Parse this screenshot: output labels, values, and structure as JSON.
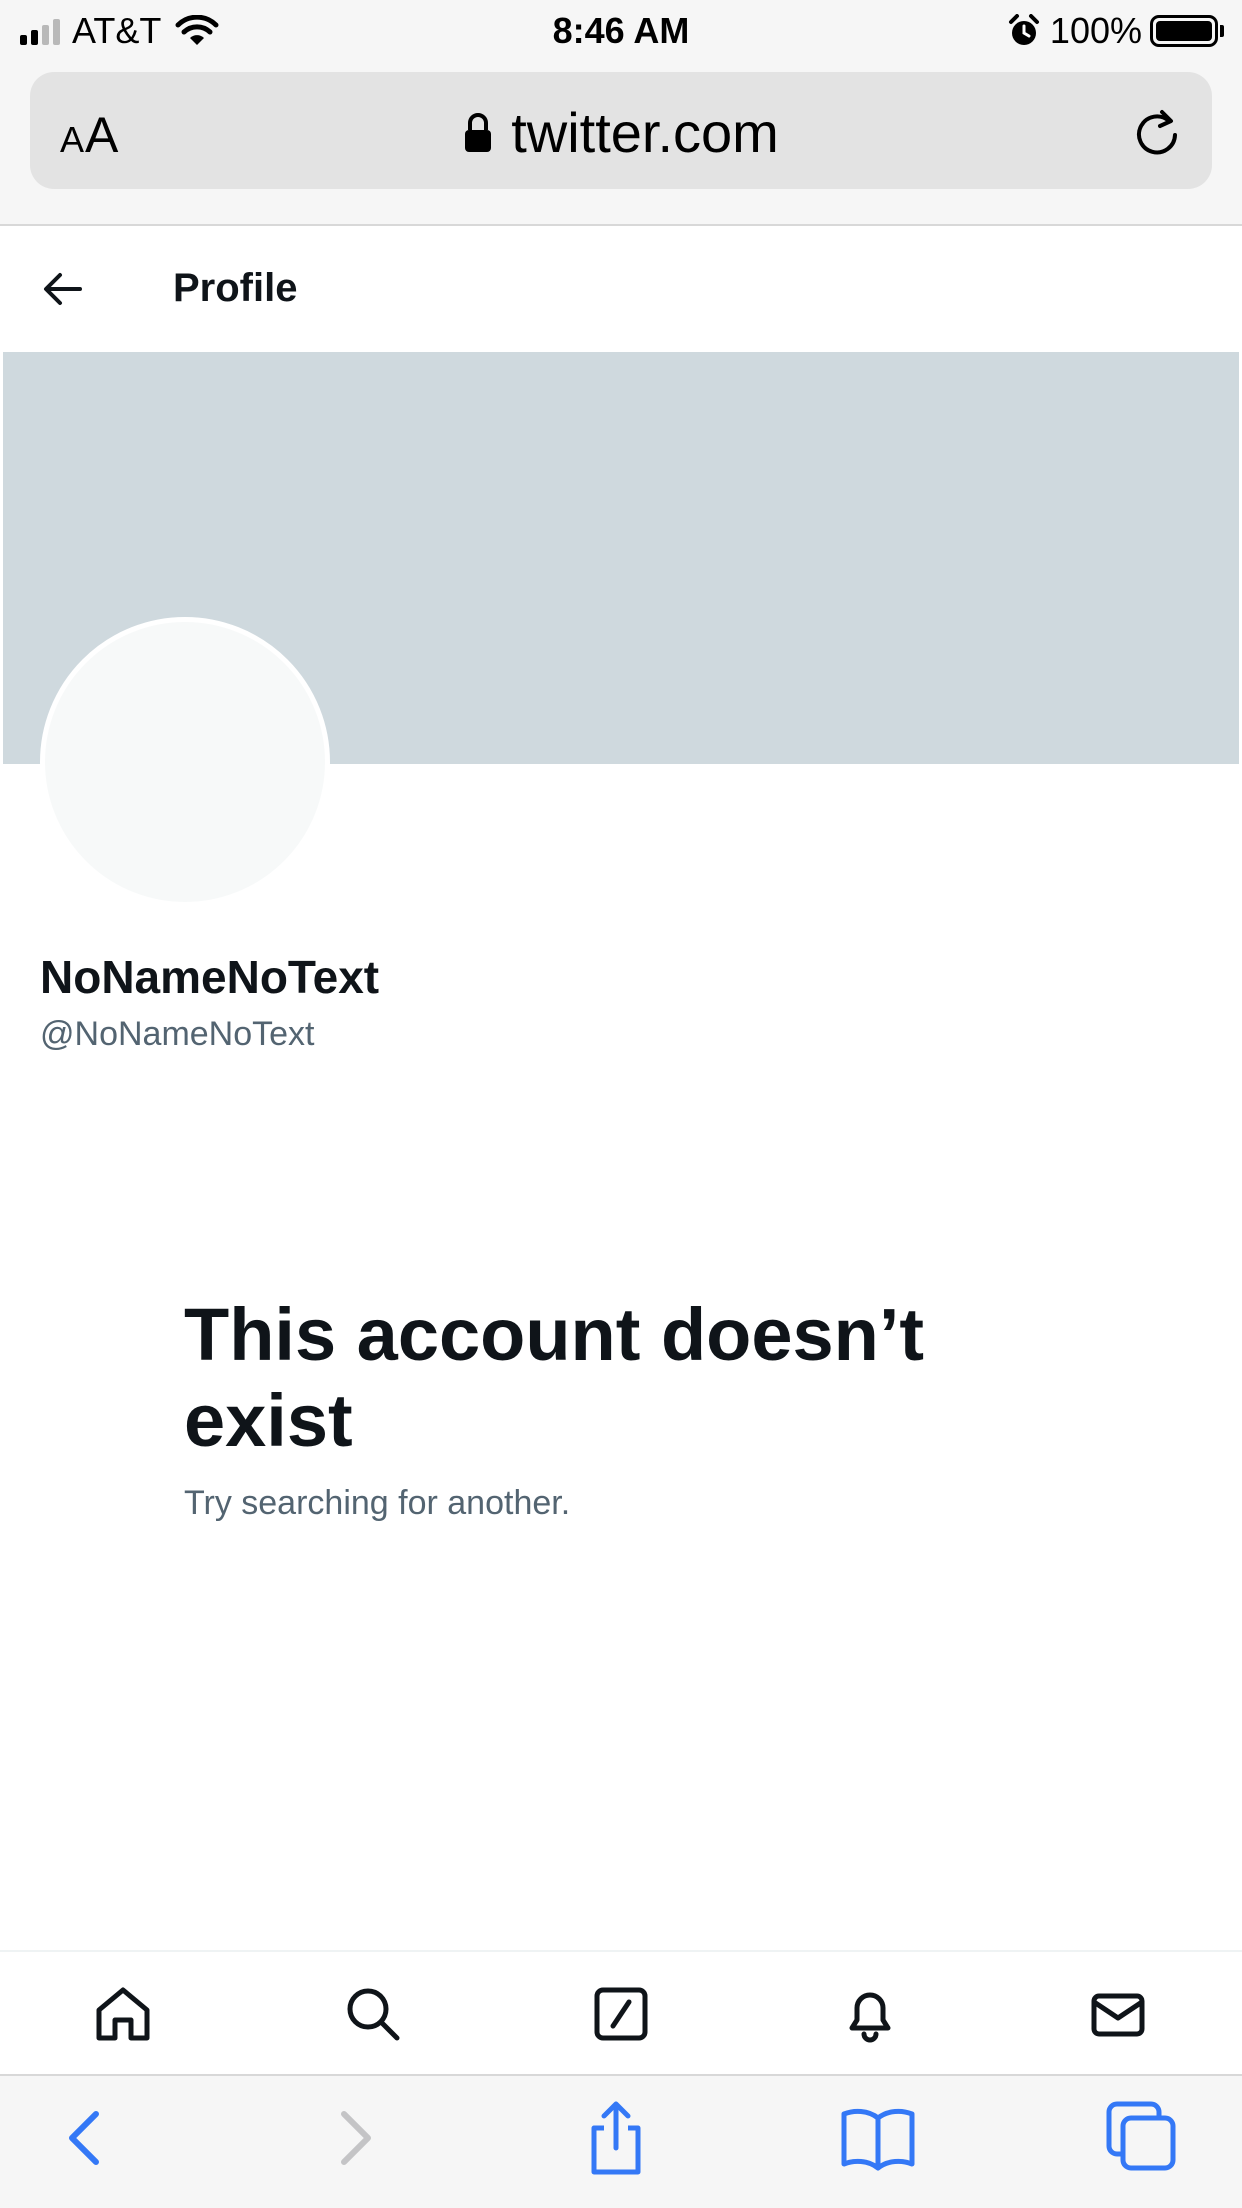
{
  "status_bar": {
    "carrier": "AT&T",
    "time": "8:46 AM",
    "battery": "100%",
    "icons": [
      "signal-icon",
      "wifi-icon",
      "alarm-icon",
      "battery-icon"
    ]
  },
  "browser": {
    "text_size_button": {
      "small": "A",
      "large": "A"
    },
    "url": "twitter.com",
    "icons": [
      "lock-icon",
      "reload-icon"
    ]
  },
  "header": {
    "title": "Profile",
    "back_icon": "back-arrow-icon"
  },
  "profile": {
    "display_name": "NoNameNoText",
    "handle": "@NoNameNoText"
  },
  "empty_state": {
    "title": "This account doesn’t exist",
    "subtitle": "Try searching for another."
  },
  "bottom_nav": {
    "items": [
      "home-icon",
      "search-icon",
      "compose-icon",
      "notifications-icon",
      "messages-icon"
    ]
  },
  "safari_toolbar": {
    "items": [
      "back-icon",
      "forward-icon",
      "share-icon",
      "bookmarks-icon",
      "tabs-icon"
    ],
    "accent_color": "#3478f6",
    "disabled_color": "#c4c4c6"
  }
}
